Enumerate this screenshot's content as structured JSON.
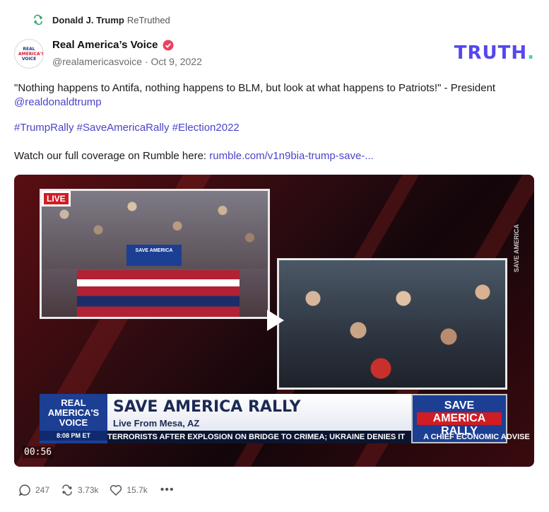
{
  "retruth": {
    "user": "Donald J. Trump",
    "label": "ReTruthed"
  },
  "author": {
    "name": "Real America’s Voice",
    "handle": "@realamericasvoice",
    "separator": "·",
    "date": "Oct 9, 2022",
    "avatar_lines": [
      "REAL",
      "AMERICA'S",
      "VOICE"
    ]
  },
  "logo": {
    "text": "TRUTH",
    "dot": "."
  },
  "post": {
    "quote": "\"Nothing happens to Antifa, nothing happens to BLM, but look at what happens to Patriots!\" - President",
    "mention": "@realdonaldtrump",
    "hashtags": "#TrumpRally #SaveAmericaRally #Election2022",
    "coverage_text": "Watch our full coverage on Rumble here:",
    "coverage_link": "rumble.com/v1n9bia-trump-save-..."
  },
  "video": {
    "live_badge": "LIVE",
    "podium_text": "SAVE AMERICA",
    "side_text": "SAVE AMERICA",
    "network_line1": "REAL",
    "network_line2": "AMERICA'S",
    "network_line3": "VOICE",
    "network_time": "8:08 PM ET",
    "headline": "SAVE AMERICA RALLY",
    "subline": "Live From Mesa, AZ",
    "badge_top": "SAVE",
    "badge_mid": "AMERICA",
    "badge_bot": "RALLY",
    "ticker_1": "TERRORISTS AFTER EXPLOSION ON BRIDGE TO CRIMEA; UKRAINE DENIES IT",
    "ticker_2": "A CHIEF ECONOMIC ADVISE",
    "timestamp": "00:56"
  },
  "actions": {
    "replies": "247",
    "retruths": "3.73k",
    "likes": "15.7k",
    "more": "•••"
  },
  "colors": {
    "brand": "#5448ee",
    "accent": "#3ed6a6",
    "link": "#4b43c9"
  }
}
